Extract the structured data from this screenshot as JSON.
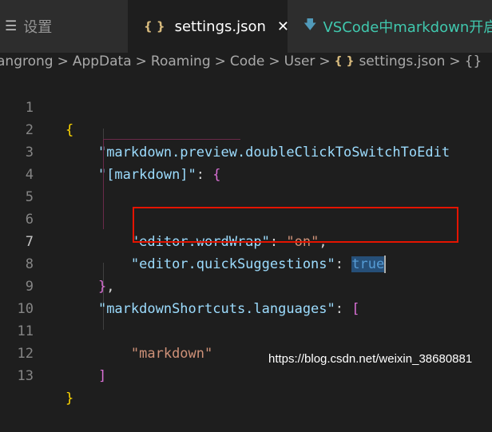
{
  "tabs": [
    {
      "icon": "settings-list-icon",
      "label": "设置"
    },
    {
      "icon": "json-braces-icon",
      "label": "settings.json",
      "active": true
    },
    {
      "icon": "markdown-arrow-icon",
      "label": "VSCode中markdown开启"
    }
  ],
  "breadcrumb": {
    "items": [
      "angrong",
      "AppData",
      "Roaming",
      "Code",
      "User",
      "settings.json",
      "{}"
    ],
    "separator": ">"
  },
  "editor": {
    "lines": [
      {
        "n": "1"
      },
      {
        "n": "2",
        "key": "\"markdown.preview.doubleClickToSwitchToEdit"
      },
      {
        "n": "3",
        "key": "\"[markdown]\"",
        "rest": ": "
      },
      {
        "n": "4"
      },
      {
        "n": "5"
      },
      {
        "n": "6",
        "key": "\"editor.wordWrap\"",
        "val": "\"on\""
      },
      {
        "n": "7",
        "key": "\"editor.quickSuggestions\"",
        "val": "true"
      },
      {
        "n": "8"
      },
      {
        "n": "9",
        "key": "\"markdownShortcuts.languages\""
      },
      {
        "n": "10"
      },
      {
        "n": "11",
        "val": "\"markdown\""
      },
      {
        "n": "12"
      },
      {
        "n": "13"
      }
    ],
    "active_line": "7"
  },
  "watermark": "https://blog.csdn.net/weixin_38680881",
  "colors": {
    "highlight_box": "#e51400",
    "string": "#ce9178",
    "key": "#9cdcfe",
    "keyword": "#569cd6"
  }
}
